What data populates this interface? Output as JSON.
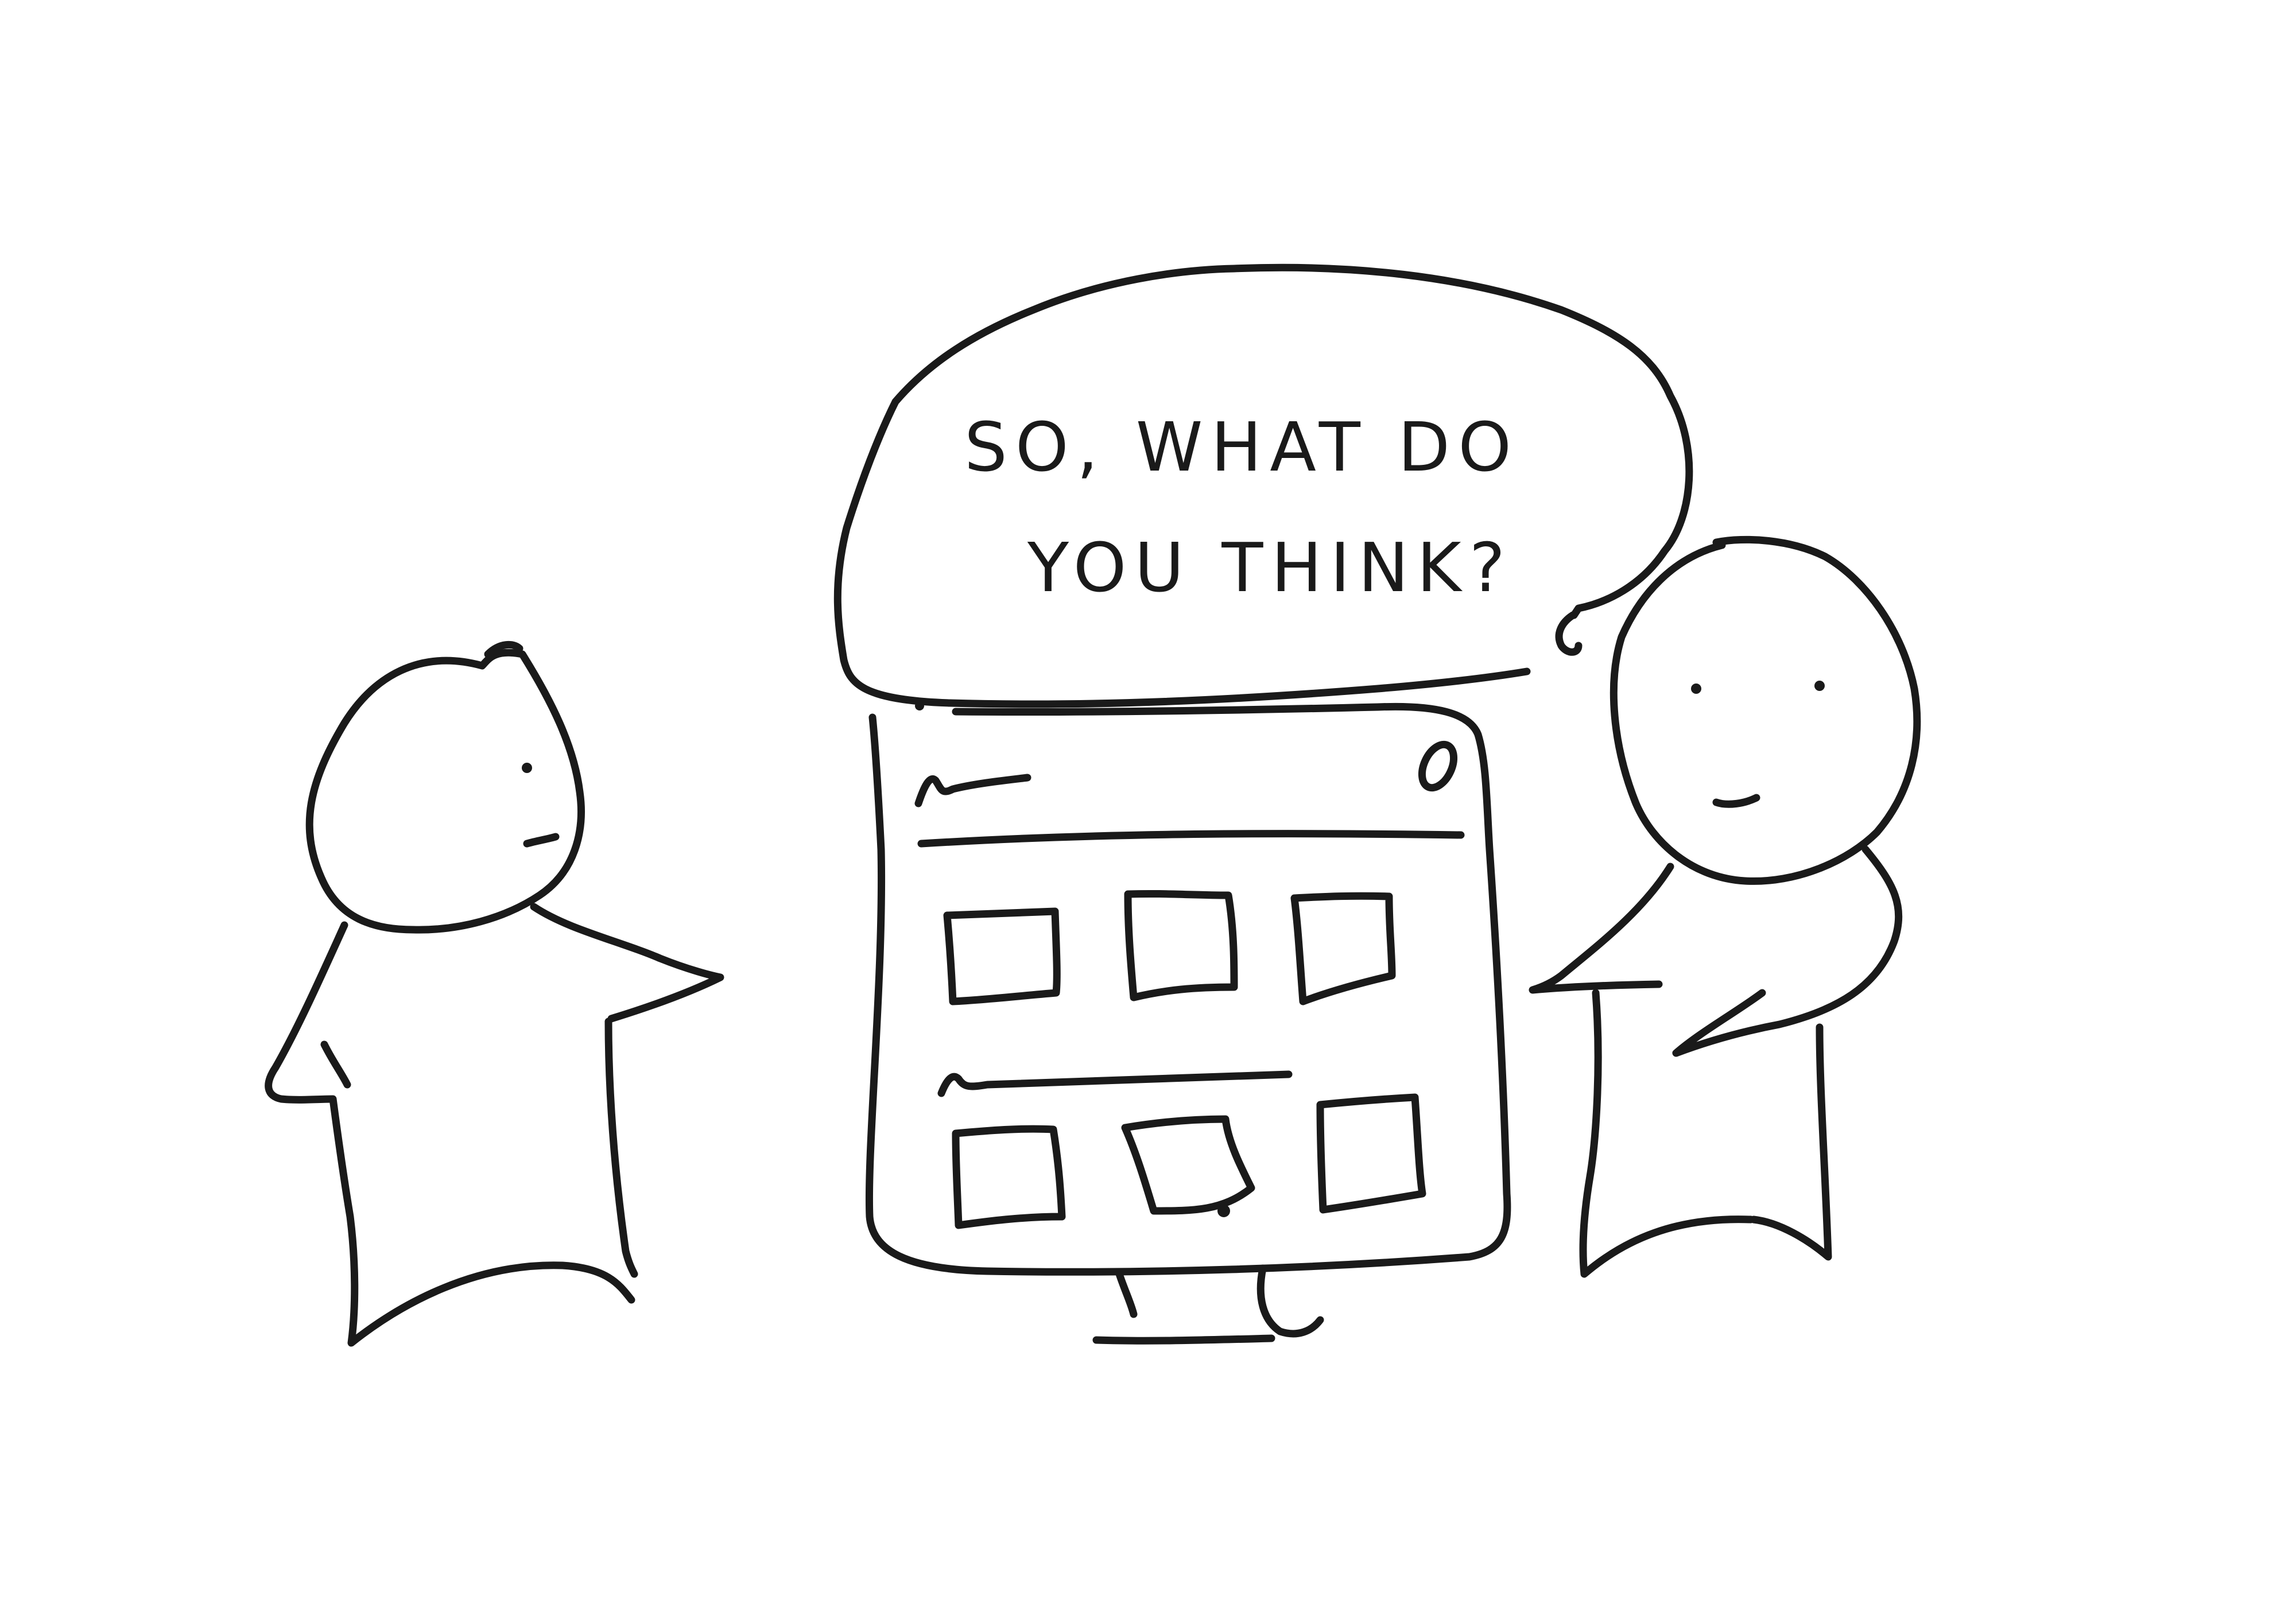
{
  "speech_bubble": {
    "line1": "SO, WHAT DO",
    "line2": "YOU THINK?"
  },
  "colors": {
    "ink": "#1a1a1a",
    "paper": "#ffffff"
  },
  "icons": {
    "monitor": "computer-monitor",
    "close": "window-close-circle"
  }
}
